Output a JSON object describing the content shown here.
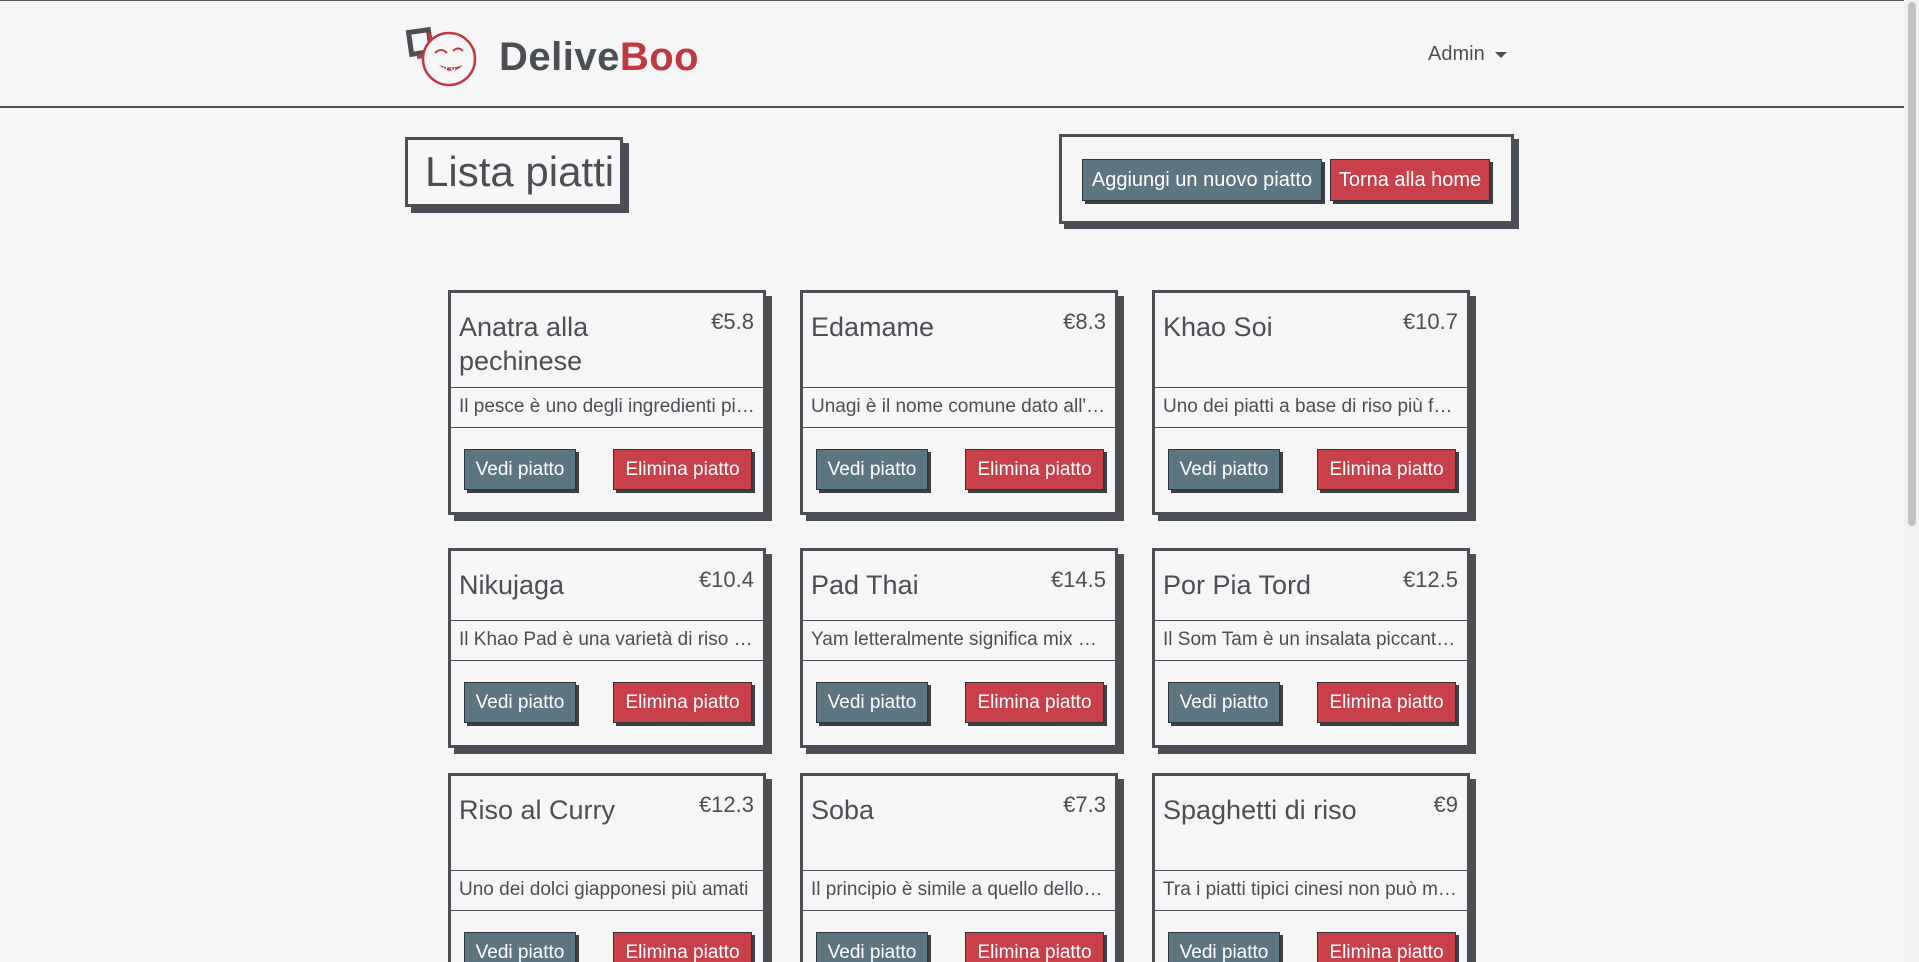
{
  "navbar": {
    "brand_part1": "Delive",
    "brand_part2": "Boo",
    "user_menu": "Admin"
  },
  "page": {
    "title": "Lista piatti",
    "add_button": "Aggiungi un nuovo piatto",
    "home_button": "Torna alla home"
  },
  "card_buttons": {
    "view": "Vedi piatto",
    "delete": "Elimina piatto"
  },
  "dishes": [
    {
      "name": "Anatra alla pechinese",
      "price": "€5.8",
      "description": "Il pesce è uno degli ingredienti più utilizzati nella cucina giapponese"
    },
    {
      "name": "Edamame",
      "price": "€8.3",
      "description": "Unagi è il nome comune dato all'anguilla d'acqua dolce"
    },
    {
      "name": "Khao Soi",
      "price": "€10.7",
      "description": "Uno dei piatti a base di riso più famosi"
    },
    {
      "name": "Nikujaga",
      "price": "€10.4",
      "description": "Il Khao Pad è una varietà di riso fritto tailandese"
    },
    {
      "name": "Pad Thai",
      "price": "€14.5",
      "description": "Yam letteralmente significa mix di ingredienti"
    },
    {
      "name": "Por Pia Tord",
      "price": "€12.5",
      "description": "Il Som Tam è un insalata piccante di papaya verde"
    },
    {
      "name": "Riso al Curry",
      "price": "€12.3",
      "description": "Uno dei dolci giapponesi più amati"
    },
    {
      "name": "Soba",
      "price": "€7.3",
      "description": "Il principio è simile a quello dello shabu shabu"
    },
    {
      "name": "Spaghetti di riso",
      "price": "€9",
      "description": "Tra i piatti tipici cinesi non può mancare"
    }
  ]
}
